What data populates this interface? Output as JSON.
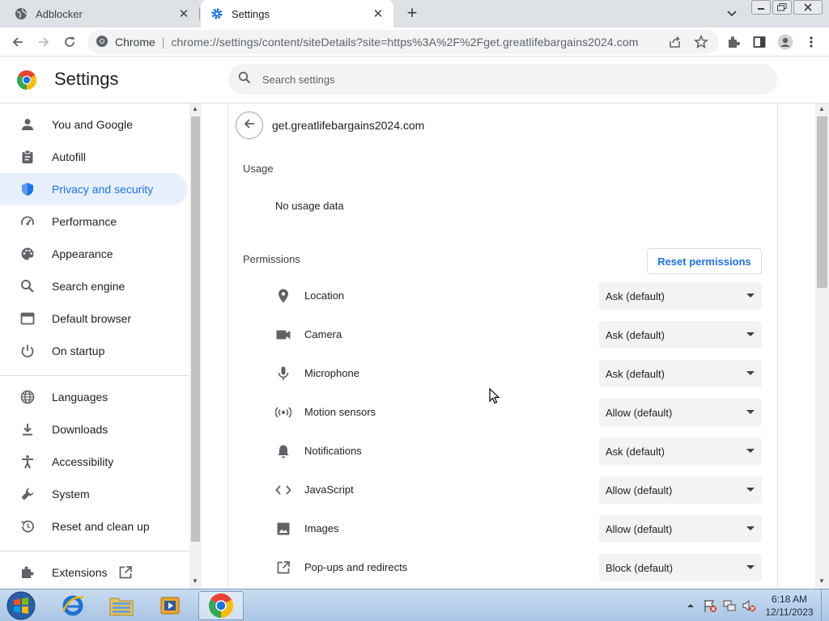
{
  "tabs": [
    {
      "title": "Adblocker",
      "icon": "globe-icon",
      "active": false
    },
    {
      "title": "Settings",
      "icon": "gear-icon",
      "active": true
    }
  ],
  "toolbar": {
    "omnibox_label": "Chrome",
    "omnibox_separator": "|",
    "url": "chrome://settings/content/siteDetails?site=https%3A%2F%2Fget.greatlifebargains2024.com"
  },
  "header": {
    "title": "Settings",
    "search_placeholder": "Search settings"
  },
  "sidebar": {
    "items": [
      {
        "label": "You and Google",
        "icon": "person-icon"
      },
      {
        "label": "Autofill",
        "icon": "clipboard-icon"
      },
      {
        "label": "Privacy and security",
        "icon": "shield-icon",
        "selected": true
      },
      {
        "label": "Performance",
        "icon": "gauge-icon"
      },
      {
        "label": "Appearance",
        "icon": "palette-icon"
      },
      {
        "label": "Search engine",
        "icon": "search-icon"
      },
      {
        "label": "Default browser",
        "icon": "browser-window-icon"
      },
      {
        "label": "On startup",
        "icon": "power-icon"
      },
      {
        "label": "Languages",
        "icon": "globe-icon"
      },
      {
        "label": "Downloads",
        "icon": "download-icon"
      },
      {
        "label": "Accessibility",
        "icon": "accessibility-icon"
      },
      {
        "label": "System",
        "icon": "wrench-icon"
      },
      {
        "label": "Reset and clean up",
        "icon": "history-icon"
      },
      {
        "label": "Extensions",
        "icon": "puzzle-icon"
      }
    ]
  },
  "site": {
    "host": "get.greatlifebargains2024.com",
    "usage_heading": "Usage",
    "usage_value": "No usage data",
    "permissions_heading": "Permissions",
    "reset_button": "Reset permissions",
    "permissions": [
      {
        "label": "Location",
        "value": "Ask (default)",
        "icon": "location-pin-icon"
      },
      {
        "label": "Camera",
        "value": "Ask (default)",
        "icon": "camera-icon"
      },
      {
        "label": "Microphone",
        "value": "Ask (default)",
        "icon": "microphone-icon"
      },
      {
        "label": "Motion sensors",
        "value": "Allow (default)",
        "icon": "motion-sensor-icon"
      },
      {
        "label": "Notifications",
        "value": "Ask (default)",
        "icon": "bell-icon"
      },
      {
        "label": "JavaScript",
        "value": "Allow (default)",
        "icon": "code-icon"
      },
      {
        "label": "Images",
        "value": "Allow (default)",
        "icon": "image-icon"
      },
      {
        "label": "Pop-ups and redirects",
        "value": "Block (default)",
        "icon": "open-in-new-icon"
      }
    ]
  },
  "taskbar": {
    "time": "6:18 AM",
    "date": "12/11/2023"
  },
  "colors": {
    "accent": "#1a73e8",
    "selected_bg": "#e8f0fe",
    "tabstrip": "#dee1e6"
  }
}
